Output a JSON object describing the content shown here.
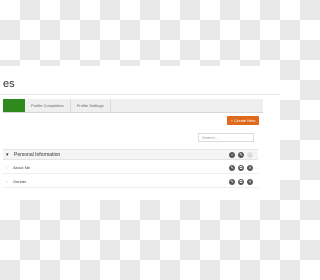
{
  "page": {
    "title": "es"
  },
  "tabs": [
    {
      "label": "Basic Info"
    },
    {
      "label": "Profile Completion"
    },
    {
      "label": "Profile Settings"
    }
  ],
  "toolbar": {
    "create_label": "+ Create New"
  },
  "search": {
    "placeholder": "Search..."
  },
  "section": {
    "title": "Personal Information",
    "caret": "▾",
    "actions": {
      "add": "+",
      "edit": "✎",
      "collapse": "–"
    }
  },
  "rows": [
    {
      "label": "About Me",
      "bullet": "○",
      "edit": "✎",
      "copy": "⧉",
      "delete": "✕"
    },
    {
      "label": "Gender",
      "bullet": "○",
      "edit": "✎",
      "copy": "⧉",
      "delete": "✕"
    }
  ],
  "colors": {
    "accent": "#2f8a1e",
    "button": "#e06a1b"
  }
}
